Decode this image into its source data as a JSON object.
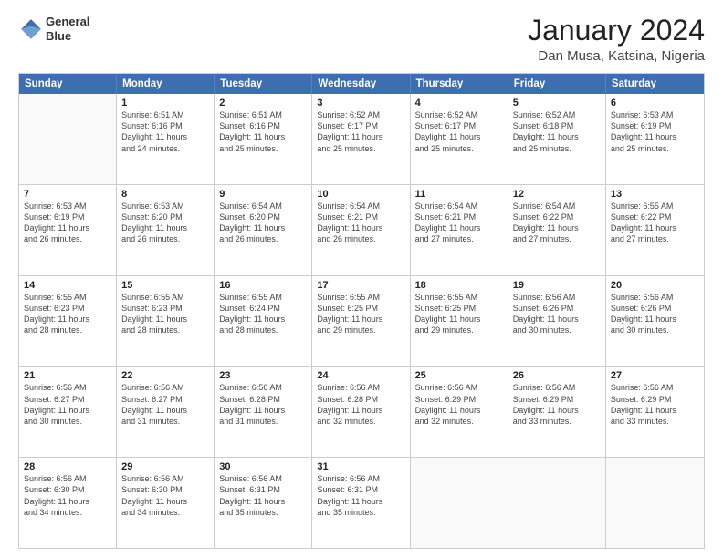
{
  "logo": {
    "line1": "General",
    "line2": "Blue"
  },
  "title": "January 2024",
  "subtitle": "Dan Musa, Katsina, Nigeria",
  "header_days": [
    "Sunday",
    "Monday",
    "Tuesday",
    "Wednesday",
    "Thursday",
    "Friday",
    "Saturday"
  ],
  "rows": [
    [
      {
        "day": "",
        "info": ""
      },
      {
        "day": "1",
        "info": "Sunrise: 6:51 AM\nSunset: 6:16 PM\nDaylight: 11 hours\nand 24 minutes."
      },
      {
        "day": "2",
        "info": "Sunrise: 6:51 AM\nSunset: 6:16 PM\nDaylight: 11 hours\nand 25 minutes."
      },
      {
        "day": "3",
        "info": "Sunrise: 6:52 AM\nSunset: 6:17 PM\nDaylight: 11 hours\nand 25 minutes."
      },
      {
        "day": "4",
        "info": "Sunrise: 6:52 AM\nSunset: 6:17 PM\nDaylight: 11 hours\nand 25 minutes."
      },
      {
        "day": "5",
        "info": "Sunrise: 6:52 AM\nSunset: 6:18 PM\nDaylight: 11 hours\nand 25 minutes."
      },
      {
        "day": "6",
        "info": "Sunrise: 6:53 AM\nSunset: 6:19 PM\nDaylight: 11 hours\nand 25 minutes."
      }
    ],
    [
      {
        "day": "7",
        "info": "Sunrise: 6:53 AM\nSunset: 6:19 PM\nDaylight: 11 hours\nand 26 minutes."
      },
      {
        "day": "8",
        "info": "Sunrise: 6:53 AM\nSunset: 6:20 PM\nDaylight: 11 hours\nand 26 minutes."
      },
      {
        "day": "9",
        "info": "Sunrise: 6:54 AM\nSunset: 6:20 PM\nDaylight: 11 hours\nand 26 minutes."
      },
      {
        "day": "10",
        "info": "Sunrise: 6:54 AM\nSunset: 6:21 PM\nDaylight: 11 hours\nand 26 minutes."
      },
      {
        "day": "11",
        "info": "Sunrise: 6:54 AM\nSunset: 6:21 PM\nDaylight: 11 hours\nand 27 minutes."
      },
      {
        "day": "12",
        "info": "Sunrise: 6:54 AM\nSunset: 6:22 PM\nDaylight: 11 hours\nand 27 minutes."
      },
      {
        "day": "13",
        "info": "Sunrise: 6:55 AM\nSunset: 6:22 PM\nDaylight: 11 hours\nand 27 minutes."
      }
    ],
    [
      {
        "day": "14",
        "info": "Sunrise: 6:55 AM\nSunset: 6:23 PM\nDaylight: 11 hours\nand 28 minutes."
      },
      {
        "day": "15",
        "info": "Sunrise: 6:55 AM\nSunset: 6:23 PM\nDaylight: 11 hours\nand 28 minutes."
      },
      {
        "day": "16",
        "info": "Sunrise: 6:55 AM\nSunset: 6:24 PM\nDaylight: 11 hours\nand 28 minutes."
      },
      {
        "day": "17",
        "info": "Sunrise: 6:55 AM\nSunset: 6:25 PM\nDaylight: 11 hours\nand 29 minutes."
      },
      {
        "day": "18",
        "info": "Sunrise: 6:55 AM\nSunset: 6:25 PM\nDaylight: 11 hours\nand 29 minutes."
      },
      {
        "day": "19",
        "info": "Sunrise: 6:56 AM\nSunset: 6:26 PM\nDaylight: 11 hours\nand 30 minutes."
      },
      {
        "day": "20",
        "info": "Sunrise: 6:56 AM\nSunset: 6:26 PM\nDaylight: 11 hours\nand 30 minutes."
      }
    ],
    [
      {
        "day": "21",
        "info": "Sunrise: 6:56 AM\nSunset: 6:27 PM\nDaylight: 11 hours\nand 30 minutes."
      },
      {
        "day": "22",
        "info": "Sunrise: 6:56 AM\nSunset: 6:27 PM\nDaylight: 11 hours\nand 31 minutes."
      },
      {
        "day": "23",
        "info": "Sunrise: 6:56 AM\nSunset: 6:28 PM\nDaylight: 11 hours\nand 31 minutes."
      },
      {
        "day": "24",
        "info": "Sunrise: 6:56 AM\nSunset: 6:28 PM\nDaylight: 11 hours\nand 32 minutes."
      },
      {
        "day": "25",
        "info": "Sunrise: 6:56 AM\nSunset: 6:29 PM\nDaylight: 11 hours\nand 32 minutes."
      },
      {
        "day": "26",
        "info": "Sunrise: 6:56 AM\nSunset: 6:29 PM\nDaylight: 11 hours\nand 33 minutes."
      },
      {
        "day": "27",
        "info": "Sunrise: 6:56 AM\nSunset: 6:29 PM\nDaylight: 11 hours\nand 33 minutes."
      }
    ],
    [
      {
        "day": "28",
        "info": "Sunrise: 6:56 AM\nSunset: 6:30 PM\nDaylight: 11 hours\nand 34 minutes."
      },
      {
        "day": "29",
        "info": "Sunrise: 6:56 AM\nSunset: 6:30 PM\nDaylight: 11 hours\nand 34 minutes."
      },
      {
        "day": "30",
        "info": "Sunrise: 6:56 AM\nSunset: 6:31 PM\nDaylight: 11 hours\nand 35 minutes."
      },
      {
        "day": "31",
        "info": "Sunrise: 6:56 AM\nSunset: 6:31 PM\nDaylight: 11 hours\nand 35 minutes."
      },
      {
        "day": "",
        "info": ""
      },
      {
        "day": "",
        "info": ""
      },
      {
        "day": "",
        "info": ""
      }
    ]
  ]
}
